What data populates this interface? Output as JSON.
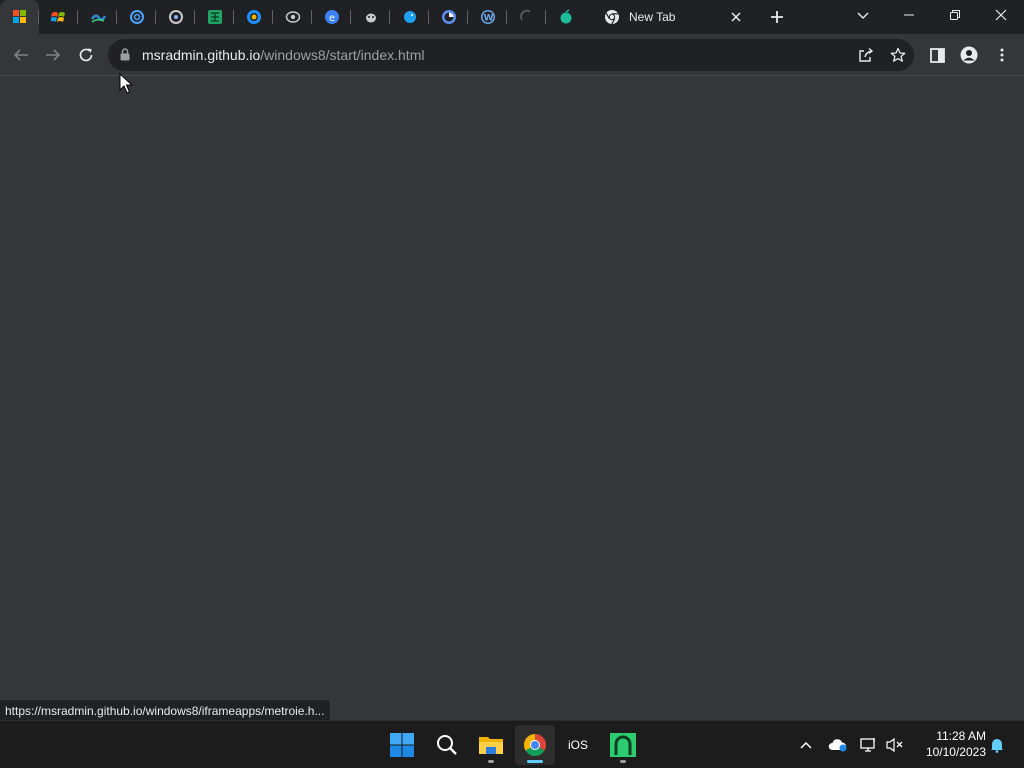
{
  "browser": {
    "pinned_tabs": [
      {
        "icon": "windows-flag-icon",
        "color": "#f0b400"
      },
      {
        "icon": "windows-xp-flag-icon",
        "color": "#e05a1c"
      },
      {
        "icon": "tilde-app-icon",
        "color": "#2d8bd1"
      },
      {
        "icon": "ring-app-icon",
        "color": "#4aa3ff"
      },
      {
        "icon": "disc-app-icon",
        "color": "#8ab4f8"
      },
      {
        "icon": "spreadsheet-app-icon",
        "color": "#21a366"
      },
      {
        "icon": "e-app-icon",
        "color": "#1e90ff"
      },
      {
        "icon": "eye-app-icon",
        "color": "#9aa0a6"
      },
      {
        "icon": "blue-e-app-icon",
        "color": "#3b82f6"
      },
      {
        "icon": "mascot-app-icon",
        "color": "#9aa0a6"
      },
      {
        "icon": "bird-app-icon",
        "color": "#1da1f2"
      },
      {
        "icon": "firefox-app-icon",
        "color": "#5a8dee"
      },
      {
        "icon": "wordpress-app-icon",
        "color": "#6aa7e8"
      },
      {
        "icon": "loading-spinner-icon",
        "color": "#5f6368"
      },
      {
        "icon": "teal-app-icon",
        "color": "#1abc9c"
      }
    ],
    "active_tab": {
      "title": "New Tab",
      "icon": "chrome-icon"
    },
    "url": {
      "host": "msradmin.github.io",
      "path": "/windows8/start/index.html"
    },
    "status_url": "https://msradmin.github.io/windows8/iframeapps/metroie.h..."
  },
  "taskbar": {
    "apps": [
      {
        "name": "start-button",
        "icon": "windows-logo-icon"
      },
      {
        "name": "search-button",
        "icon": "search-icon"
      },
      {
        "name": "file-explorer-button",
        "icon": "folder-icon"
      },
      {
        "name": "chrome-button",
        "icon": "chrome-icon"
      },
      {
        "name": "ios-app-button",
        "icon": "ios-icon",
        "label": "iOS"
      },
      {
        "name": "green-app-button",
        "icon": "arch-icon"
      }
    ],
    "clock": {
      "time": "11:28 AM",
      "date": "10/10/2023"
    }
  }
}
